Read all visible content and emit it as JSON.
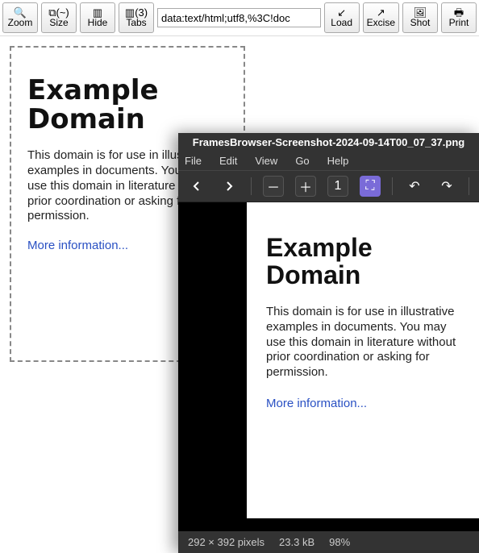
{
  "toolbar": {
    "zoom": {
      "icon": "🔍",
      "label": "Zoom"
    },
    "size": {
      "icon": "⧉(~)",
      "label": "Size"
    },
    "hide": {
      "icon": "▥",
      "label": "Hide"
    },
    "tabs": {
      "icon": "▥(3)",
      "label": "Tabs"
    },
    "load": {
      "icon": "↙",
      "label": "Load"
    },
    "excise": {
      "icon": "↗",
      "label": "Excise"
    },
    "shot": {
      "icon": "🖼",
      "label": "Shot"
    },
    "print": {
      "icon": "🖶",
      "label": "Print"
    }
  },
  "urlbar": {
    "value": "data:text/html;utf8,%3C!doc"
  },
  "page": {
    "title": "Example Domain",
    "body": "This domain is for use in illustrative examples in documents. You may use this domain in literature without prior coordination or asking for permission.",
    "more": "More information..."
  },
  "viewer": {
    "title": "FramesBrowser-Screenshot-2024-09-14T00_07_37.png",
    "menu": {
      "file": "File",
      "edit": "Edit",
      "view": "View",
      "go": "Go",
      "help": "Help"
    },
    "zoom_value": "1",
    "status": {
      "dims": "292 × 392 pixels",
      "size": "23.3 kB",
      "zoom": "98%"
    }
  }
}
